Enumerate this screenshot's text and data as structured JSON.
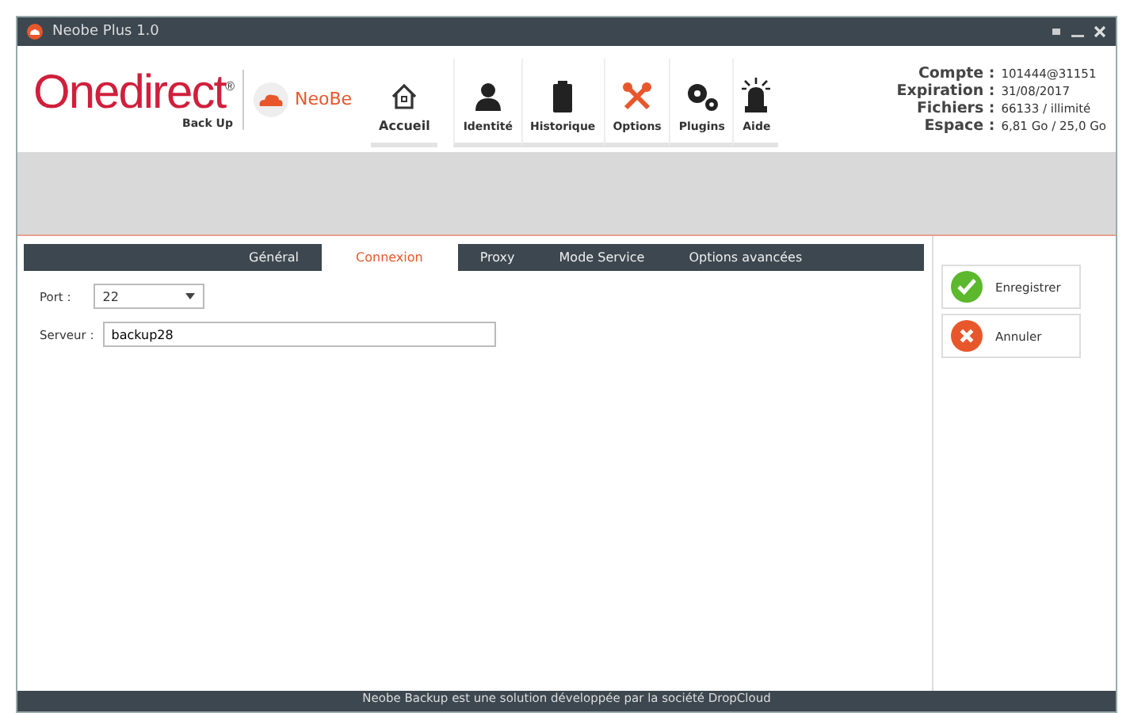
{
  "window": {
    "title": "Neobe Plus 1.0"
  },
  "logo": {
    "brand": "Onedirect",
    "mark": "®",
    "subtitle": "Back Up",
    "partner": "NeoBe"
  },
  "nav": [
    {
      "label": "Accueil",
      "kind": "home",
      "selected": true
    },
    {
      "label": "Identité",
      "kind": "person",
      "selected": false
    },
    {
      "label": "Historique",
      "kind": "battery",
      "selected": false
    },
    {
      "label": "Options",
      "kind": "tools",
      "selected": false
    },
    {
      "label": "Plugins",
      "kind": "gears",
      "selected": false
    },
    {
      "label": "Aide",
      "kind": "siren",
      "selected": false
    }
  ],
  "account": [
    {
      "label": "Compte :",
      "value": "101444@31151"
    },
    {
      "label": "Expiration :",
      "value": "31/08/2017"
    },
    {
      "label": "Fichiers :",
      "value": "66133 / illimité"
    },
    {
      "label": "Espace :",
      "value": "6,81 Go / 25,0 Go"
    }
  ],
  "tabs": [
    {
      "label": "Général",
      "selected": false
    },
    {
      "label": "Connexion",
      "selected": true
    },
    {
      "label": "Proxy",
      "selected": false
    },
    {
      "label": "Mode Service",
      "selected": false
    },
    {
      "label": "Options avancées",
      "selected": false
    }
  ],
  "form": {
    "port": {
      "label": "Port :",
      "value": "22"
    },
    "server": {
      "label": "Serveur :",
      "value": "backup28"
    }
  },
  "actions": [
    {
      "label": "Enregistrer",
      "kind": "save"
    },
    {
      "label": "Annuler",
      "kind": "cancel"
    }
  ],
  "footer": "Neobe Backup est une solution développée par la société DropCloud"
}
